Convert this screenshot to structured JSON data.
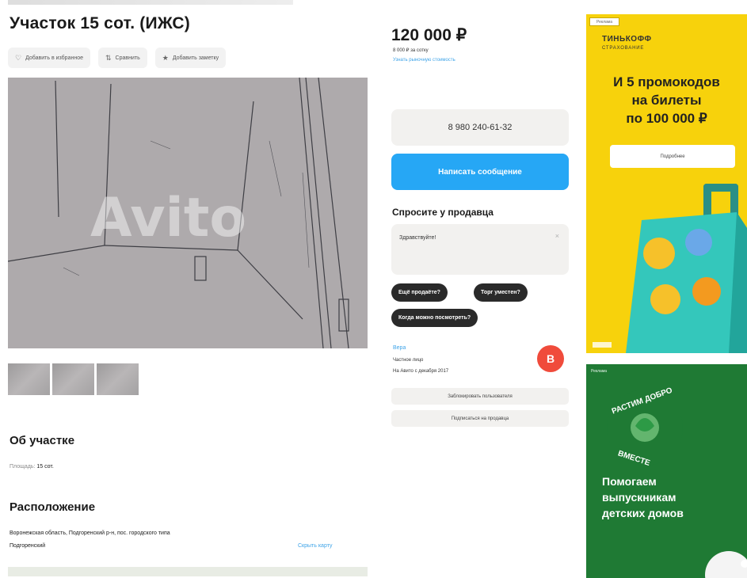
{
  "listing": {
    "title": "Участок 15 сот. (ИЖС)",
    "actions": [
      {
        "icon": "heart-icon",
        "label": "Добавить в избранное"
      },
      {
        "icon": "compare-icon",
        "label": "Сравнить"
      },
      {
        "icon": "star-icon",
        "label": "Добавить заметку"
      }
    ],
    "watermark": "Avito",
    "thumbnail_count": 3
  },
  "about": {
    "heading": "Об участке",
    "area_label": "Площадь:",
    "area_value": "15 сот."
  },
  "location": {
    "heading": "Расположение",
    "address_line1": "Воронежская область, Подгоренский р-н, пос. городского типа",
    "address_line2": "Подгоренский",
    "map_link": "Скрыть карту"
  },
  "price": {
    "value": "120 000 ₽",
    "per_unit": "8 000 ₽ за сотку",
    "link": "Узнать рыночную стоимость"
  },
  "contact": {
    "phone": "8 980 240-61-32",
    "message_button": "Написать сообщение"
  },
  "ask": {
    "heading": "Спросите у продавца",
    "placeholder": "Здравствуйте!",
    "chips": [
      "Ещё продаёте?",
      "Торг уместен?",
      "Когда можно посмотреть?"
    ]
  },
  "seller": {
    "name": "Вера",
    "type": "Частное лицо",
    "since": "На Авито с декабря 2017",
    "avatar_letter": "В",
    "avatar_color": "#f04b3b",
    "buttons": [
      "Заблокировать пользователя",
      "Подписаться на продавца"
    ]
  },
  "ads": {
    "ad1": {
      "tag": "Реклама",
      "brand": "ТИНЬКОФФ",
      "brand_sub": "СТРАХОВАНИЕ",
      "headline": [
        "И 5 промокодов",
        "на билеты",
        "по 100 000 ₽"
      ],
      "cta": "Подробнее",
      "bg": "#f7d20c"
    },
    "ad2": {
      "tag": "Реклама",
      "logo_top": "РАСТИМ ДОБРО",
      "logo_bottom": "ВМЕСТЕ",
      "text": [
        "Помогаем",
        "выпускникам",
        "детских домов"
      ],
      "bg": "#1f7a34"
    }
  },
  "colors": {
    "accent_blue": "#26a7f5",
    "link_blue": "#3fa4e8"
  }
}
